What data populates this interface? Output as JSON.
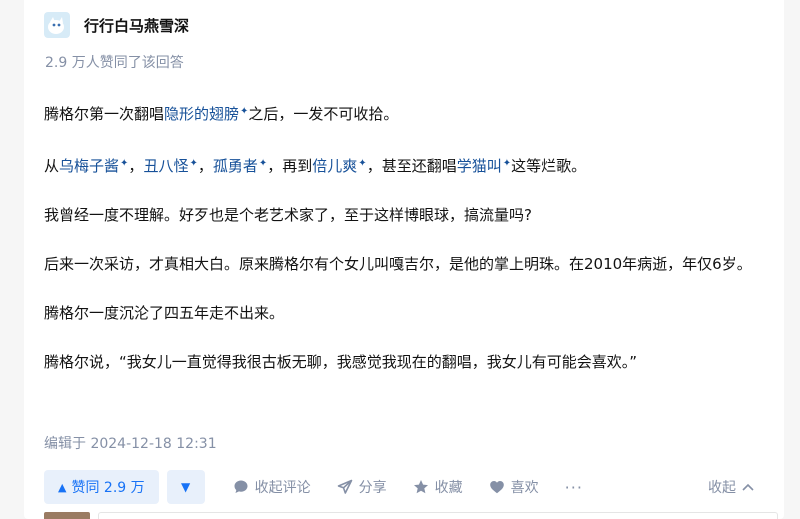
{
  "author": {
    "name": "行行白马燕雪深"
  },
  "vote_summary": "2.9 万人赞同了该回答",
  "content": {
    "p1": {
      "a": "腾格尔第一次翻唱",
      "k1": "隐形的翅膀",
      "b": "之后，一发不可收拾。"
    },
    "p2": {
      "a": "从",
      "k1": "乌梅子酱",
      "s1": "，",
      "k2": "丑八怪",
      "s2": "，",
      "k3": "孤勇者",
      "s3": "，再到",
      "k4": "倍儿爽",
      "s4": "，甚至还翻唱",
      "k5": "学猫叫",
      "b": "这等烂歌。"
    },
    "p3": "我曾经一度不理解。好歹也是个老艺术家了，至于这样博眼球，搞流量吗?",
    "p4": "后来一次采访，才真相大白。原来腾格尔有个女儿叫嘎吉尔，是他的掌上明珠。在2010年病逝，年仅6岁。",
    "p5": "腾格尔一度沉沦了四五年走不出来。",
    "p6": "腾格尔说，“我女儿一直觉得我很古板无聊，我感觉我现在的翻唱，我女儿有可能会喜欢。”"
  },
  "edited": "编辑于 2024-12-18 12:31",
  "actions": {
    "vote_up": "赞同 2.9 万",
    "comment": "收起评论",
    "share": "分享",
    "favorite": "收藏",
    "like": "喜欢",
    "more": "···",
    "collapse": "收起"
  },
  "colors": {
    "link": "#175199",
    "accent": "#1772f6",
    "muted": "#8590a6"
  },
  "icons": [
    "avatar-icon",
    "keyword-spark-icon",
    "vote-up-triangle-icon",
    "vote-down-triangle-icon",
    "comment-icon",
    "share-icon",
    "star-icon",
    "heart-icon",
    "chevron-up-icon"
  ]
}
